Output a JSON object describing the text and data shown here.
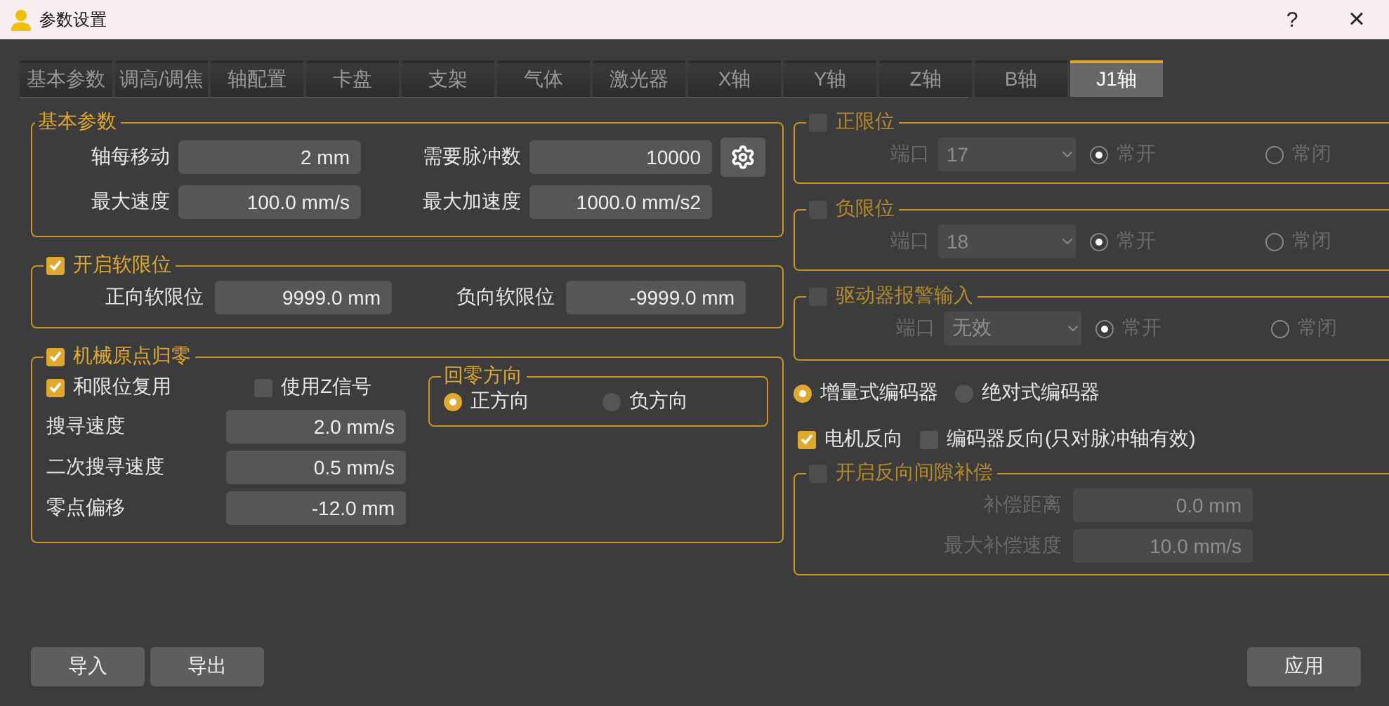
{
  "window": {
    "title": "参数设置",
    "help": "?",
    "close": "×"
  },
  "tabs": [
    {
      "label": "基本参数",
      "selected": false
    },
    {
      "label": "调高/调焦",
      "selected": false
    },
    {
      "label": "轴配置",
      "selected": false
    },
    {
      "label": "卡盘",
      "selected": false
    },
    {
      "label": "支架",
      "selected": false
    },
    {
      "label": "气体",
      "selected": false
    },
    {
      "label": "激光器",
      "selected": false
    },
    {
      "label": "X轴",
      "selected": false
    },
    {
      "label": "Y轴",
      "selected": false
    },
    {
      "label": "Z轴",
      "selected": false
    },
    {
      "label": "B轴",
      "selected": false
    },
    {
      "label": "J1轴",
      "selected": true
    }
  ],
  "basic": {
    "title": "基本参数",
    "fields": [
      {
        "label": "轴每移动",
        "value": "2 mm"
      },
      {
        "label": "需要脉冲数",
        "value": "10000"
      },
      {
        "label": "最大速度",
        "value": "100.0 mm/s"
      },
      {
        "label": "最大加速度",
        "value": "1000.0 mm/s2"
      }
    ]
  },
  "soft_limit": {
    "title": "开启软限位",
    "checked": true,
    "fields": [
      {
        "label": "正向软限位",
        "value": "9999.0 mm"
      },
      {
        "label": "负向软限位",
        "value": "-9999.0 mm"
      }
    ]
  },
  "homing": {
    "title": "机械原点归零",
    "checked": true,
    "options": [
      {
        "label": "和限位复用",
        "checked": true
      },
      {
        "label": "使用Z信号",
        "checked": false
      }
    ],
    "fields": [
      {
        "label": "搜寻速度",
        "value": "2.0 mm/s"
      },
      {
        "label": "二次搜寻速度",
        "value": "0.5 mm/s"
      },
      {
        "label": "零点偏移",
        "value": "-12.0 mm"
      }
    ],
    "direction": {
      "title": "回零方向",
      "options": [
        {
          "label": "正方向",
          "selected": true
        },
        {
          "label": "负方向",
          "selected": false
        }
      ]
    }
  },
  "limits": [
    {
      "title": "正限位",
      "checked": false,
      "port_label": "端口",
      "port": "17",
      "modes": [
        {
          "label": "常开",
          "selected": true
        },
        {
          "label": "常闭",
          "selected": false
        }
      ]
    },
    {
      "title": "负限位",
      "checked": false,
      "port_label": "端口",
      "port": "18",
      "modes": [
        {
          "label": "常开",
          "selected": true
        },
        {
          "label": "常闭",
          "selected": false
        }
      ]
    },
    {
      "title": "驱动器报警输入",
      "checked": false,
      "port_label": "端口",
      "port": "无效",
      "modes": [
        {
          "label": "常开",
          "selected": true
        },
        {
          "label": "常闭",
          "selected": false
        }
      ]
    }
  ],
  "encoder_types": [
    {
      "label": "增量式编码器",
      "selected": true
    },
    {
      "label": "绝对式编码器",
      "selected": false
    }
  ],
  "reverse_options": [
    {
      "label": "电机反向",
      "checked": true
    },
    {
      "label": "编码器反向(只对脉冲轴有效)",
      "checked": false
    }
  ],
  "backlash": {
    "title": "开启反向间隙补偿",
    "checked": false,
    "fields": [
      {
        "label": "补偿距离",
        "value": "0.0 mm"
      },
      {
        "label": "最大补偿速度",
        "value": "10.0 mm/s"
      }
    ]
  },
  "buttons_left": [
    "导入",
    "导出"
  ],
  "buttons_right": [
    "应用"
  ]
}
